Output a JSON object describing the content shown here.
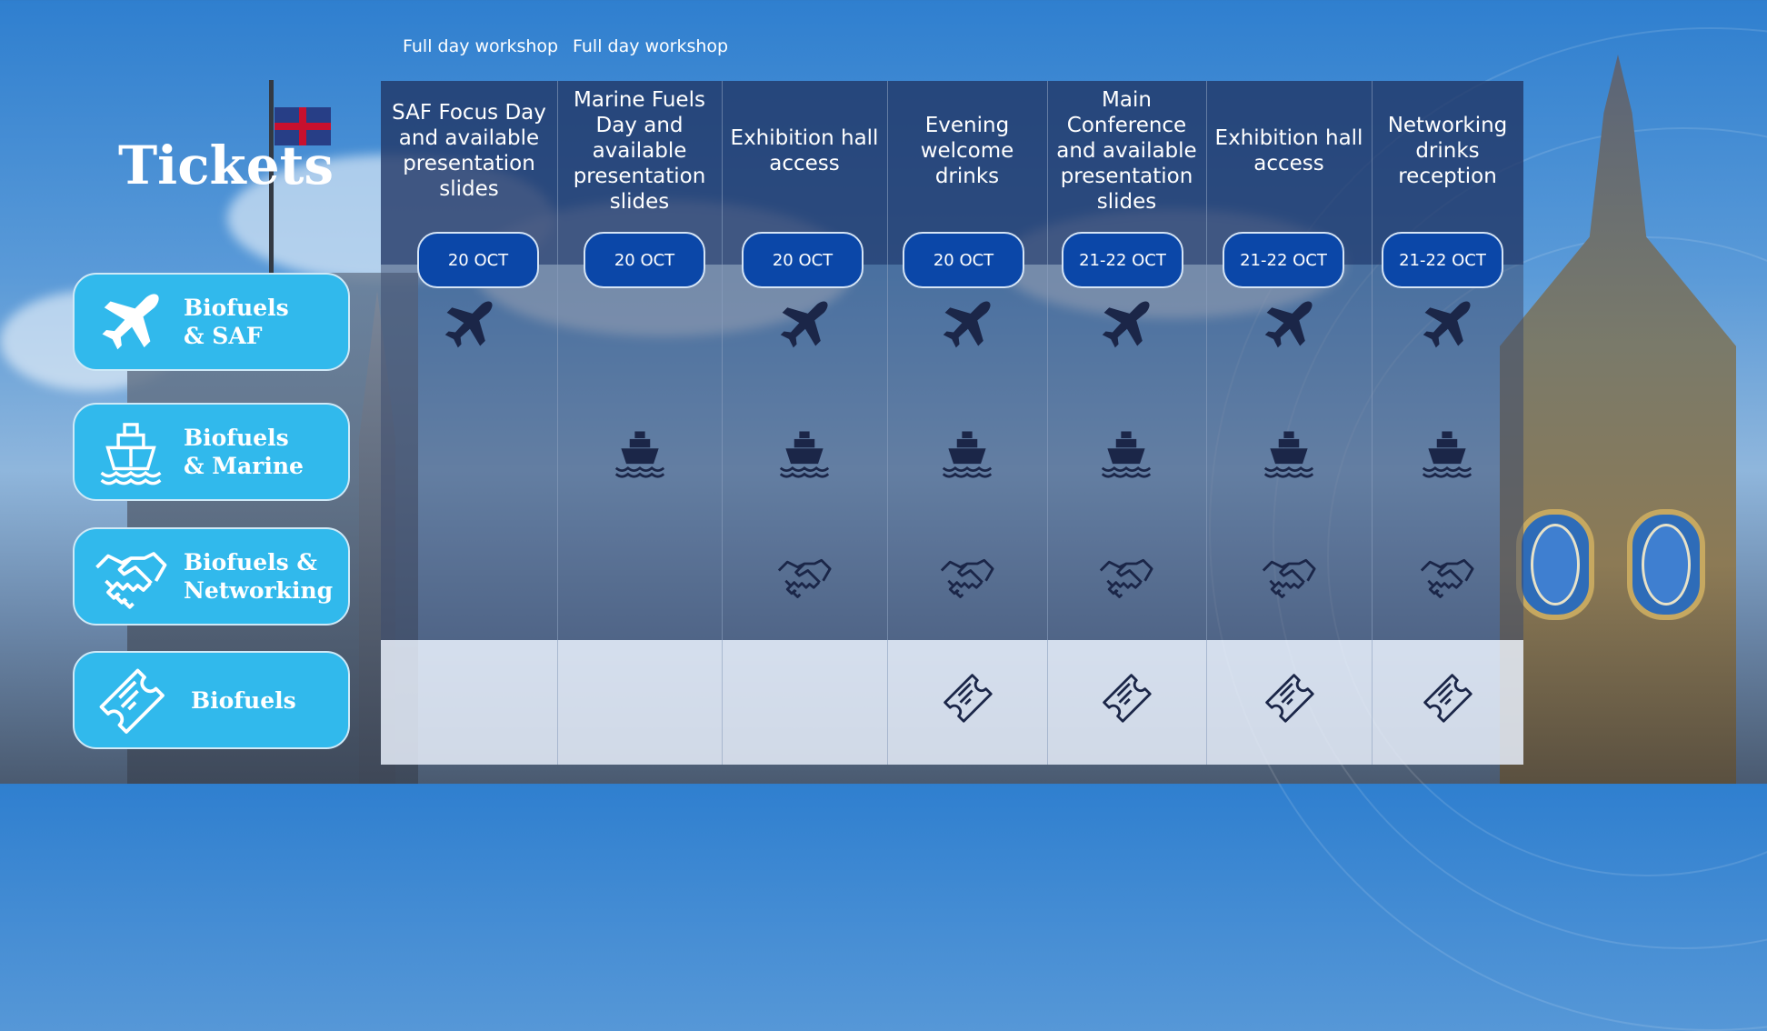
{
  "page": {
    "title": "Tickets",
    "accent_color": "#31b9ec",
    "header_color": "#203464",
    "pill_color": "#0b47a8",
    "icon_color": "#1b2648"
  },
  "captions": [
    "Full day workshop",
    "Full day workshop"
  ],
  "ticket_types": [
    {
      "label_line1": "Biofuels",
      "label_line2": "& SAF",
      "icon": "plane-icon"
    },
    {
      "label_line1": "Biofuels",
      "label_line2": "& Marine",
      "icon": "ship-icon"
    },
    {
      "label_line1": "Biofuels &",
      "label_line2": "Networking",
      "icon": "handshake-icon"
    },
    {
      "label_line1": "Biofuels",
      "label_line2": "",
      "icon": "ticket-icon"
    }
  ],
  "columns": [
    {
      "heading": "SAF Focus Day and available presentation slides",
      "date": "20 OCT"
    },
    {
      "heading": "Marine Fuels Day and available presentation slides",
      "date": "20 OCT"
    },
    {
      "heading": "Exhibition hall access",
      "date": "20 OCT"
    },
    {
      "heading": "Evening welcome drinks",
      "date": "20 OCT"
    },
    {
      "heading": "Main Conference and available presentation slides",
      "date": "21-22 OCT"
    },
    {
      "heading": "Exhibition hall access",
      "date": "21-22 OCT"
    },
    {
      "heading": "Networking drinks reception",
      "date": "21-22 OCT"
    }
  ],
  "inclusion_matrix": {
    "rows": [
      "Biofuels & SAF",
      "Biofuels & Marine",
      "Biofuels & Networking",
      "Biofuels"
    ],
    "included": [
      [
        true,
        false,
        true,
        true,
        true,
        true,
        true
      ],
      [
        false,
        true,
        true,
        true,
        true,
        true,
        true
      ],
      [
        false,
        false,
        true,
        true,
        true,
        true,
        true
      ],
      [
        false,
        false,
        false,
        true,
        true,
        true,
        true
      ]
    ]
  }
}
